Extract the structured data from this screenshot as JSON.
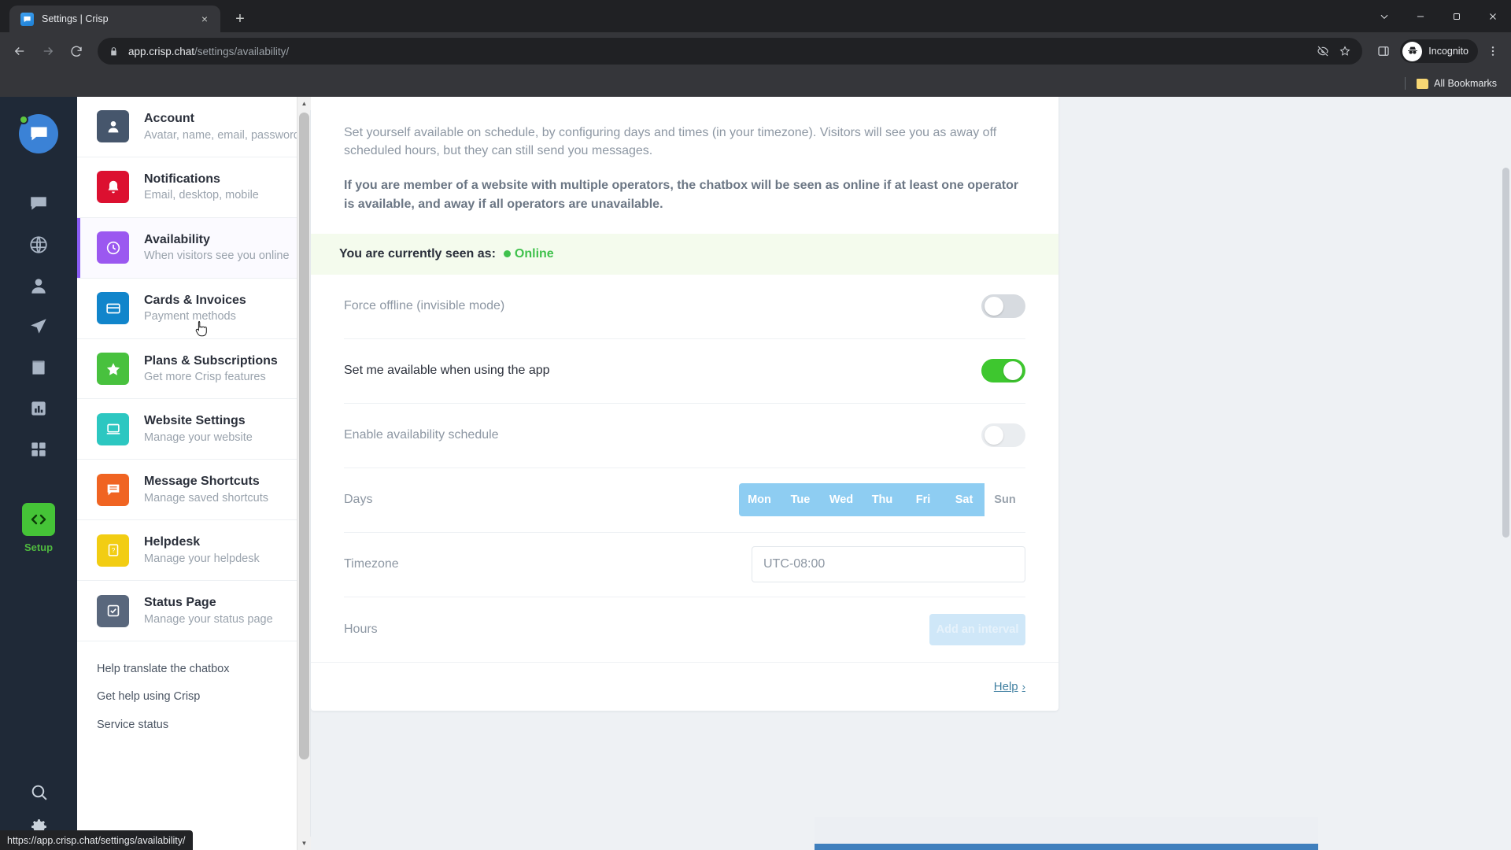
{
  "browser": {
    "tab": {
      "title": "Settings | Crisp",
      "favicon": "crisp-chat-icon",
      "close": "×"
    },
    "new_tab": "+",
    "window_controls": {
      "collapse": "chevron-down-icon",
      "minimize": "minimize-icon",
      "maximize": "restore-icon",
      "close": "close-icon"
    },
    "nav": {
      "back": "back-arrow-icon",
      "forward": "forward-arrow-icon",
      "reload": "reload-icon"
    },
    "omnibox": {
      "lock": "lock-icon",
      "host": "app.crisp.chat",
      "path": "/settings/availability/",
      "full_url": "app.crisp.chat/settings/availability/",
      "tracking_protection": "eye-slash-icon",
      "bookmark": "star-icon"
    },
    "side_panel": "side-panel-icon",
    "profile": {
      "label": "Incognito",
      "icon": "incognito-icon"
    },
    "menu": "kebab-menu-icon",
    "bookmarks_bar": {
      "label": "All Bookmarks",
      "icon": "folder-icon"
    },
    "status_bar_url": "https://app.crisp.chat/settings/availability/"
  },
  "rail": {
    "avatar": {
      "icon": "chat-avatar-icon",
      "presence": "online"
    },
    "items": [
      {
        "name": "inbox",
        "icon": "chat-bubble-icon"
      },
      {
        "name": "visitors",
        "icon": "globe-icon"
      },
      {
        "name": "contacts",
        "icon": "person-icon"
      },
      {
        "name": "campaigns",
        "icon": "paper-plane-icon"
      },
      {
        "name": "helpdesk",
        "icon": "book-icon"
      },
      {
        "name": "analytics",
        "icon": "bar-chart-icon"
      },
      {
        "name": "plugins",
        "icon": "grid-icon"
      }
    ],
    "setup": {
      "label": "Setup",
      "icon": "code-brackets-icon"
    },
    "search": "search-icon",
    "settings": "gear-icon"
  },
  "settings_nav": {
    "items": [
      {
        "title": "Account",
        "subtitle": "Avatar, name, email, password",
        "icon": "person-icon",
        "color": "#46566c",
        "active": false
      },
      {
        "title": "Notifications",
        "subtitle": "Email, desktop, mobile",
        "icon": "bell-icon",
        "color": "#dc1030",
        "active": false
      },
      {
        "title": "Availability",
        "subtitle": "When visitors see you online",
        "icon": "clock-icon",
        "color": "#9b58f0",
        "active": true
      },
      {
        "title": "Cards & Invoices",
        "subtitle": "Payment methods",
        "icon": "credit-card-icon",
        "color": "#1185cb",
        "active": false
      },
      {
        "title": "Plans & Subscriptions",
        "subtitle": "Get more Crisp features",
        "icon": "star-icon",
        "color": "#48c13e",
        "active": false
      },
      {
        "title": "Website Settings",
        "subtitle": "Manage your website",
        "icon": "laptop-icon",
        "color": "#2cc7c1",
        "active": false
      },
      {
        "title": "Message Shortcuts",
        "subtitle": "Manage saved shortcuts",
        "icon": "message-lines-icon",
        "color": "#f06422",
        "active": false
      },
      {
        "title": "Helpdesk",
        "subtitle": "Manage your helpdesk",
        "icon": "question-doc-icon",
        "color": "#f2cd13",
        "active": false
      },
      {
        "title": "Status Page",
        "subtitle": "Manage your status page",
        "icon": "checkbox-icon",
        "color": "#59677c",
        "active": false
      }
    ],
    "footer_links": [
      "Help translate the chatbox",
      "Get help using Crisp",
      "Service status"
    ]
  },
  "availability": {
    "intro_1": "Set yourself available on schedule, by configuring days and times (in your timezone). Visitors will see you as away off scheduled hours, but they can still send you messages.",
    "intro_2": "If you are member of a website with multiple operators, the chatbox will be seen as online if at least one operator is available, and away if all operators are unavailable.",
    "status": {
      "label": "You are currently seen as:",
      "value": "Online",
      "color": "#3fc14c"
    },
    "rows": {
      "force_offline": {
        "label": "Force offline (invisible mode)",
        "state": "off"
      },
      "set_available": {
        "label": "Set me available when using the app",
        "state": "on"
      },
      "enable_schedule": {
        "label": "Enable availability schedule",
        "state": "off"
      }
    },
    "days": {
      "label": "Days",
      "options": [
        {
          "label": "Mon",
          "selected": true
        },
        {
          "label": "Tue",
          "selected": true
        },
        {
          "label": "Wed",
          "selected": true
        },
        {
          "label": "Thu",
          "selected": true
        },
        {
          "label": "Fri",
          "selected": true
        },
        {
          "label": "Sat",
          "selected": true
        },
        {
          "label": "Sun",
          "selected": false
        }
      ]
    },
    "timezone": {
      "label": "Timezone",
      "value": "UTC-08:00"
    },
    "hours": {
      "label": "Hours",
      "button": "Add an interval"
    },
    "help": {
      "label": "Help",
      "chevron": "›"
    }
  }
}
